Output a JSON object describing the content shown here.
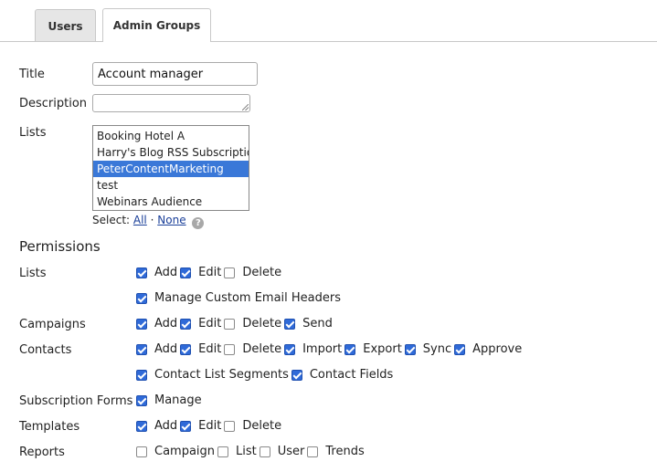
{
  "tabs": [
    {
      "label": "Users",
      "active": false
    },
    {
      "label": "Admin Groups",
      "active": true
    }
  ],
  "form": {
    "title_label": "Title",
    "title_value": "Account manager",
    "description_label": "Description",
    "description_value": "",
    "lists_label": "Lists",
    "lists_options": [
      {
        "label": "Booking Hotel A",
        "selected": false
      },
      {
        "label": "Harry's Blog RSS Subscription",
        "selected": false
      },
      {
        "label": "PeterContentMarketing",
        "selected": true
      },
      {
        "label": "test",
        "selected": false
      },
      {
        "label": "Webinars Audience",
        "selected": false
      }
    ],
    "select_prefix": "Select:",
    "select_all": "All",
    "select_sep": "·",
    "select_none": "None",
    "help_icon": "?"
  },
  "permissions": {
    "heading": "Permissions",
    "rows": [
      {
        "label": "Lists",
        "items": [
          {
            "label": "Add",
            "checked": true
          },
          {
            "label": "Edit",
            "checked": true
          },
          {
            "label": "Delete",
            "checked": false
          }
        ]
      },
      {
        "label": "",
        "items": [
          {
            "label": "Manage Custom Email Headers",
            "checked": true
          }
        ]
      },
      {
        "label": "Campaigns",
        "items": [
          {
            "label": "Add",
            "checked": true
          },
          {
            "label": "Edit",
            "checked": true
          },
          {
            "label": "Delete",
            "checked": false
          },
          {
            "label": "Send",
            "checked": true
          }
        ]
      },
      {
        "label": "Contacts",
        "items": [
          {
            "label": "Add",
            "checked": true
          },
          {
            "label": "Edit",
            "checked": true
          },
          {
            "label": "Delete",
            "checked": false
          },
          {
            "label": "Import",
            "checked": true
          },
          {
            "label": "Export",
            "checked": true
          },
          {
            "label": "Sync",
            "checked": true
          },
          {
            "label": "Approve",
            "checked": true
          }
        ]
      },
      {
        "label": "",
        "items": [
          {
            "label": "Contact List Segments",
            "checked": true
          },
          {
            "label": "Contact Fields",
            "checked": true
          }
        ]
      },
      {
        "label": "Subscription Forms",
        "items": [
          {
            "label": "Manage",
            "checked": true
          }
        ]
      },
      {
        "label": "Templates",
        "items": [
          {
            "label": "Add",
            "checked": true
          },
          {
            "label": "Edit",
            "checked": true
          },
          {
            "label": "Delete",
            "checked": false
          }
        ]
      },
      {
        "label": "Reports",
        "items": [
          {
            "label": "Campaign",
            "checked": false
          },
          {
            "label": "List",
            "checked": false
          },
          {
            "label": "User",
            "checked": false
          },
          {
            "label": "Trends",
            "checked": false
          }
        ]
      }
    ]
  },
  "colors": {
    "accent": "#3a78d8",
    "checkbox_on": "#2f6ad8",
    "link": "#1a3f99"
  }
}
